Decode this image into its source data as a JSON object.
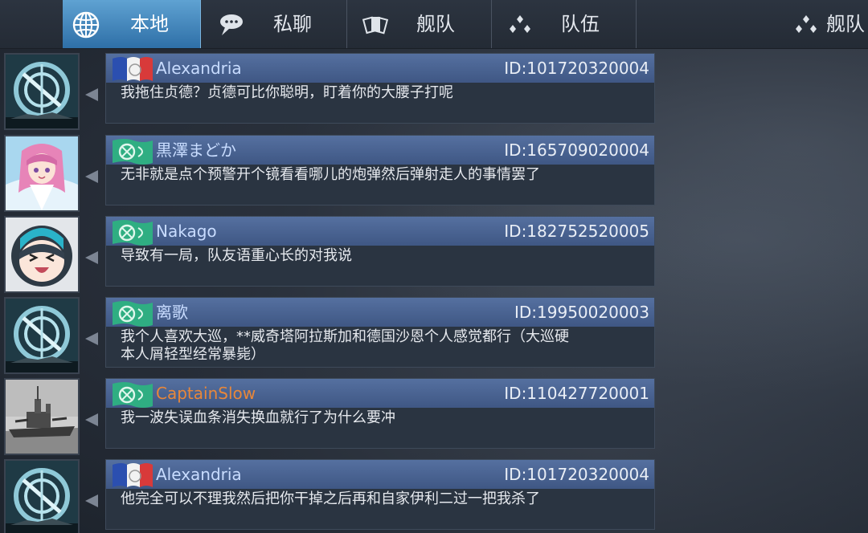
{
  "tabs": [
    {
      "label": "本地",
      "icon": "globe-icon",
      "active": true
    },
    {
      "label": "私聊",
      "icon": "chat-bubble-icon",
      "active": false
    },
    {
      "label": "舰队",
      "icon": "fleet-cards-icon",
      "active": false
    },
    {
      "label": "队伍",
      "icon": "team-diamonds-icon",
      "active": false
    },
    {
      "label": "舰队",
      "icon": "fleet-diamonds-icon",
      "active": false
    }
  ],
  "messages": [
    {
      "name": "Alexandria",
      "id": "ID:101720320004",
      "text": "我拖住贞德？贞德可比你聪明，盯着你的大腰子打呢",
      "flag": "french-flag-icon",
      "avatar": "ship-emblem-avatar",
      "name_color": "#c8dcff"
    },
    {
      "name": "黒澤まどか",
      "id": "ID:165709020004",
      "text": "无非就是点个预警开个镜看看哪儿的炮弹然后弹射走人的事情罢了",
      "flag": "green-guild-flag-icon",
      "avatar": "anime-girl-avatar",
      "name_color": "#c8dcff"
    },
    {
      "name": "Nakago",
      "id": "ID:182752520005",
      "text": "导致有一局，队友语重心长的对我说",
      "flag": "green-guild-flag-icon",
      "avatar": "chibi-girl-avatar",
      "name_color": "#c8dcff"
    },
    {
      "name": "离歌",
      "id": "ID:19950020003",
      "text": "我个人喜欢大巡，**威奇塔阿拉斯加和德国沙恩个人感觉都行（大巡硬本人屑轻型经常暴毙）",
      "flag": "green-guild-flag-icon",
      "avatar": "ship-emblem-avatar",
      "name_color": "#c8dcff"
    },
    {
      "name": "CaptainSlow",
      "id": "ID:110427720001",
      "text": "我一波失误血条消失换血就行了为什么要冲",
      "flag": "green-guild-flag-icon",
      "avatar": "battleship-photo-avatar",
      "name_color": "#e8873a"
    },
    {
      "name": "Alexandria",
      "id": "ID:101720320004",
      "text": "他完全可以不理我然后把你干掉之后再和自家伊利二过一把我杀了",
      "flag": "french-flag-icon",
      "avatar": "ship-emblem-avatar",
      "name_color": "#c8dcff"
    }
  ],
  "colors": {
    "active_tab": "#4a8ec4",
    "header_band": "#4a6494",
    "bubble_body": "#2a3441",
    "highlight_name": "#e8873a"
  }
}
